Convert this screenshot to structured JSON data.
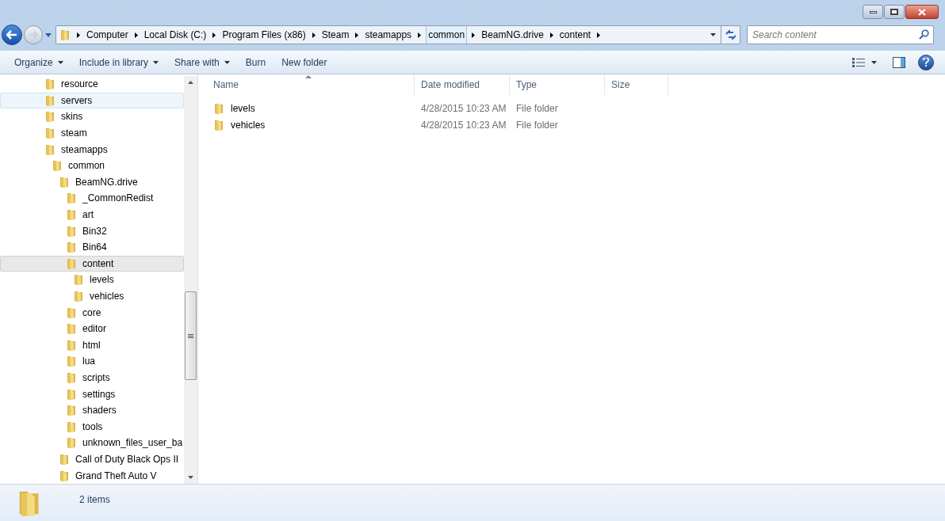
{
  "address_bar": {
    "crumbs": [
      {
        "label": "Computer",
        "selected": false
      },
      {
        "label": "Local Disk (C:)",
        "selected": false
      },
      {
        "label": "Program Files (x86)",
        "selected": false
      },
      {
        "label": "Steam",
        "selected": false
      },
      {
        "label": "steamapps",
        "selected": false
      },
      {
        "label": "common",
        "selected": true
      },
      {
        "label": "BeamNG.drive",
        "selected": false
      },
      {
        "label": "content",
        "selected": false
      }
    ]
  },
  "search": {
    "placeholder": "Search content"
  },
  "toolbar": [
    {
      "label": "Organize",
      "dropdown": true
    },
    {
      "label": "Include in library",
      "dropdown": true
    },
    {
      "label": "Share with",
      "dropdown": true
    },
    {
      "label": "Burn",
      "dropdown": false
    },
    {
      "label": "New folder",
      "dropdown": false
    }
  ],
  "sidebar": {
    "items": [
      {
        "label": "resource",
        "selected": false,
        "hovered": false
      },
      {
        "label": "servers",
        "selected": false,
        "hovered": true
      },
      {
        "label": "skins",
        "selected": false,
        "hovered": false
      },
      {
        "label": "steam",
        "selected": false,
        "hovered": false
      },
      {
        "label": "steamapps",
        "selected": false,
        "hovered": false,
        "children": [
          {
            "label": "common",
            "selected": false,
            "hovered": false,
            "children": [
              {
                "label": "BeamNG.drive",
                "selected": false,
                "hovered": false,
                "children": [
                  {
                    "label": "_CommonRedist",
                    "selected": false,
                    "hovered": false
                  },
                  {
                    "label": "art",
                    "selected": false,
                    "hovered": false
                  },
                  {
                    "label": "Bin32",
                    "selected": false,
                    "hovered": false
                  },
                  {
                    "label": "Bin64",
                    "selected": false,
                    "hovered": false
                  },
                  {
                    "label": "content",
                    "selected": true,
                    "hovered": false,
                    "children": [
                      {
                        "label": "levels",
                        "selected": false,
                        "hovered": false
                      },
                      {
                        "label": "vehicles",
                        "selected": false,
                        "hovered": false
                      }
                    ]
                  },
                  {
                    "label": "core",
                    "selected": false,
                    "hovered": false
                  },
                  {
                    "label": "editor",
                    "selected": false,
                    "hovered": false
                  },
                  {
                    "label": "html",
                    "selected": false,
                    "hovered": false
                  },
                  {
                    "label": "lua",
                    "selected": false,
                    "hovered": false
                  },
                  {
                    "label": "scripts",
                    "selected": false,
                    "hovered": false
                  },
                  {
                    "label": "settings",
                    "selected": false,
                    "hovered": false
                  },
                  {
                    "label": "shaders",
                    "selected": false,
                    "hovered": false
                  },
                  {
                    "label": "tools",
                    "selected": false,
                    "hovered": false
                  },
                  {
                    "label": "unknown_files_user_ba",
                    "selected": false,
                    "hovered": false
                  }
                ]
              },
              {
                "label": "Call of Duty Black Ops II",
                "selected": false,
                "hovered": false
              },
              {
                "label": "Grand Theft Auto V",
                "selected": false,
                "hovered": false
              }
            ]
          }
        ]
      }
    ]
  },
  "table": {
    "columns": [
      "Name",
      "Date modified",
      "Type",
      "Size"
    ],
    "rows": [
      {
        "name": "levels",
        "date_modified": "4/28/2015 10:23 AM",
        "type": "File folder"
      },
      {
        "name": "vehicles",
        "date_modified": "4/28/2015 10:23 AM",
        "type": "File folder"
      }
    ]
  },
  "status_bar": {
    "text": "2 items"
  }
}
